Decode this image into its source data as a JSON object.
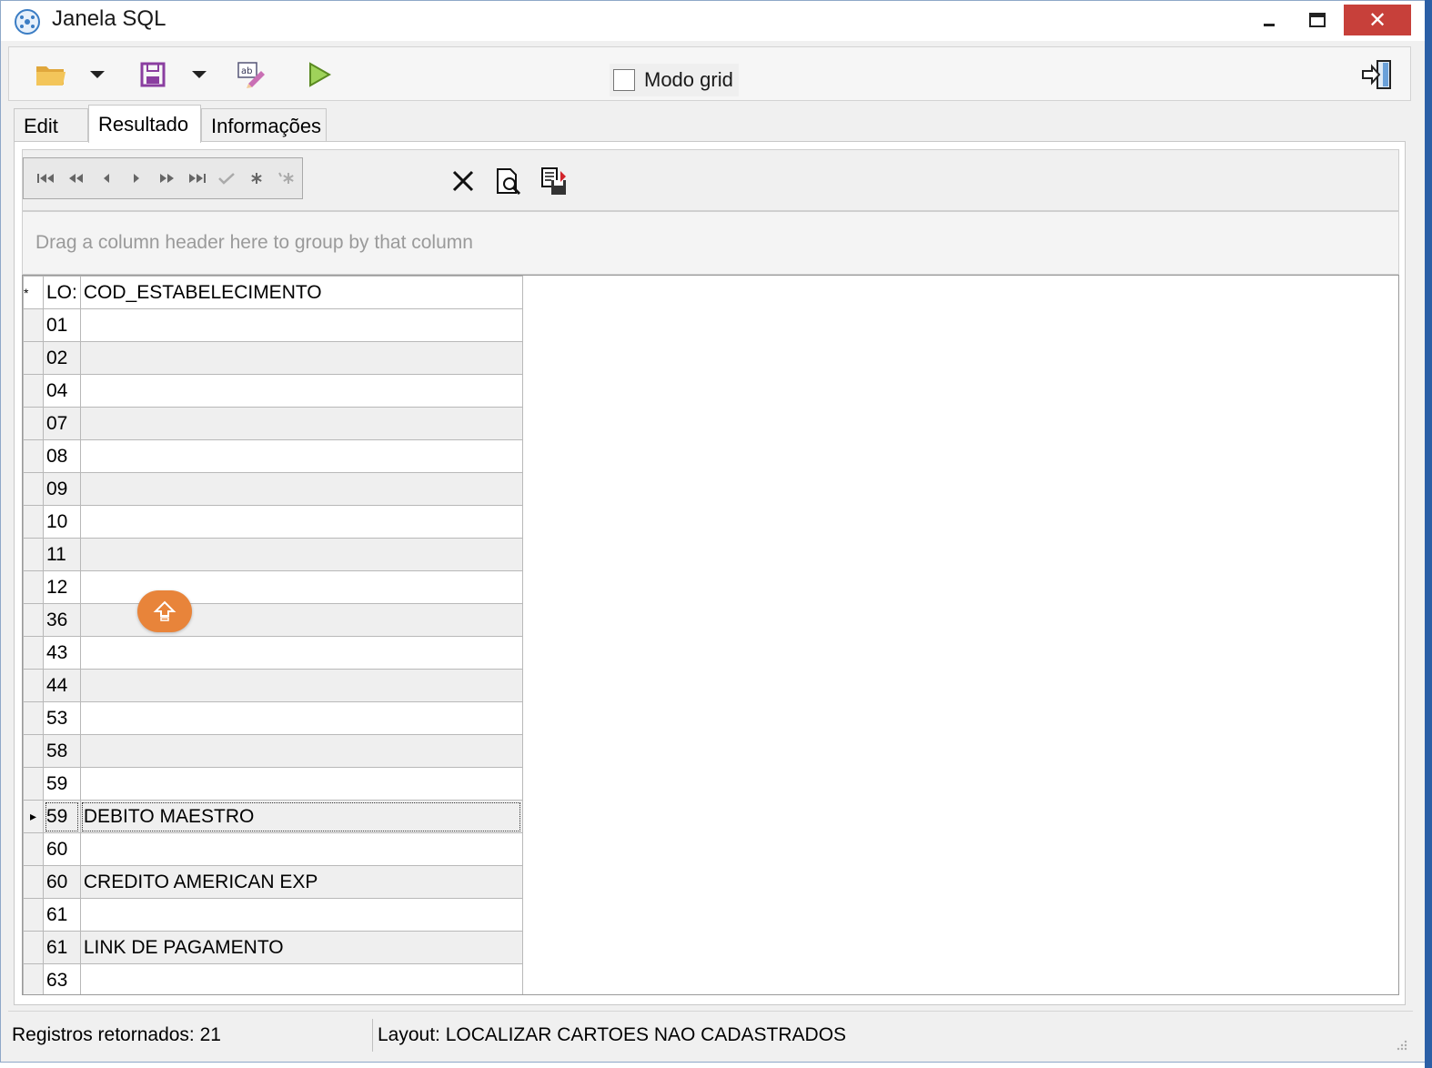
{
  "window": {
    "title": "Janela SQL",
    "close_glyph": "✕",
    "accent": "#c7403a"
  },
  "toolbar": {
    "modo_grid_label": "Modo grid",
    "modo_grid_checked": false,
    "icons": [
      "open-folder-icon",
      "save-icon",
      "edit-text-icon",
      "run-icon",
      "exit-icon"
    ]
  },
  "tabs": [
    {
      "label": "Edit"
    },
    {
      "label": "Resultado",
      "active": true
    },
    {
      "label": "Informações"
    }
  ],
  "grid": {
    "group_hint": "Drag a column header here to group by that column",
    "indicator_header": "*",
    "columns": [
      "LO:",
      "COD_ESTABELECIMENTO"
    ],
    "rows": [
      [
        "01",
        ""
      ],
      [
        "02",
        ""
      ],
      [
        "04",
        ""
      ],
      [
        "07",
        ""
      ],
      [
        "08",
        ""
      ],
      [
        "09",
        ""
      ],
      [
        "10",
        ""
      ],
      [
        "11",
        ""
      ],
      [
        "12",
        ""
      ],
      [
        "36",
        ""
      ],
      [
        "43",
        ""
      ],
      [
        "44",
        ""
      ],
      [
        "53",
        ""
      ],
      [
        "58",
        ""
      ],
      [
        "59",
        ""
      ],
      [
        "59",
        "DEBITO MAESTRO"
      ],
      [
        "60",
        ""
      ],
      [
        "60",
        "CREDITO AMERICAN EXP"
      ],
      [
        "61",
        ""
      ],
      [
        "61",
        "LINK DE PAGAMENTO"
      ],
      [
        "63",
        ""
      ]
    ],
    "selected_row_index": 15,
    "current_row_glyph": "▸"
  },
  "status": {
    "left": "Registros retornados: 21",
    "right": "Layout: LOCALIZAR CARTOES NAO CADASTRADOS"
  },
  "colors": {
    "float_button": "#e8843a",
    "alt_row": "#efefef"
  }
}
